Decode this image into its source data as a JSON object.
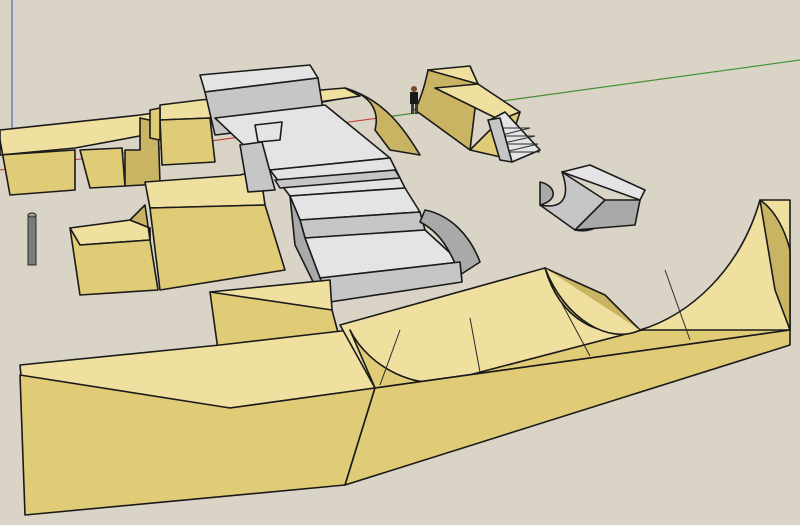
{
  "viewport": {
    "background": "#d9d4c5",
    "axes": {
      "red": "#c4332a",
      "green": "#2aa33a",
      "blue": "#3c4fb8"
    },
    "materials": {
      "wood_top": "#f0e0a0",
      "wood_side": "#e0cc76",
      "wood_dark": "#c8b462",
      "concrete_top": "#e4e4e4",
      "concrete_side": "#c6c6c6",
      "concrete_dark": "#a9a9a9"
    }
  },
  "objects": [
    {
      "name": "left-funbox",
      "material": "wood"
    },
    {
      "name": "back-launch-box",
      "material": "wood"
    },
    {
      "name": "left-ledge-box",
      "material": "wood"
    },
    {
      "name": "concrete-stair-set",
      "material": "concrete"
    },
    {
      "name": "concrete-quarter-pipe",
      "material": "concrete"
    },
    {
      "name": "stair-quarter",
      "material": "wood"
    },
    {
      "name": "rail-post",
      "material": "metal"
    },
    {
      "name": "skater-figure",
      "material": "figure"
    },
    {
      "name": "front-box",
      "material": "wood"
    },
    {
      "name": "mini-ramp",
      "material": "wood"
    }
  ]
}
